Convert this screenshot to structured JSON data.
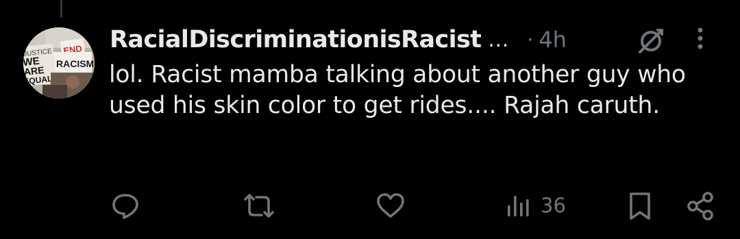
{
  "post": {
    "author": {
      "display_name": "RacialDiscriminationisRacist",
      "truncation": "...",
      "avatar_signs": [
        "END",
        "RACISM",
        "WE",
        "ARE",
        "EQUAL",
        "JUSTICE"
      ]
    },
    "separator": "·",
    "timestamp": "4h",
    "text": "lol. Racist mamba talking about another guy who used his skin color to get rides.... Rajah caruth."
  },
  "actions": {
    "views_count": "36",
    "icons": [
      "reply-icon",
      "repost-icon",
      "like-icon",
      "views-icon",
      "bookmark-icon",
      "share-icon"
    ]
  },
  "colors": {
    "background": "#000000",
    "text_primary": "#e7e9ea",
    "text_secondary": "#71767b",
    "icon": "#71767b",
    "thread_line": "#333639",
    "sign_red": "#c0392b"
  }
}
